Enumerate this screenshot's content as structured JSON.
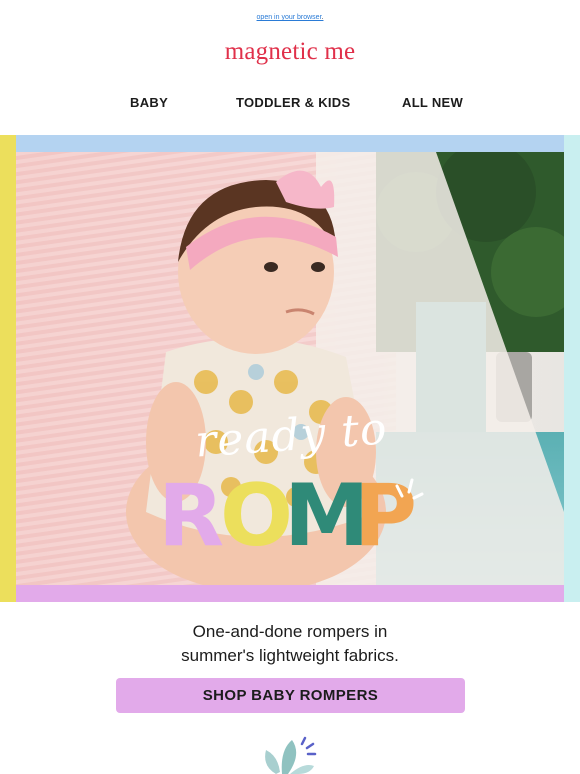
{
  "preheader": {
    "link_text": "open in your browser",
    "suffix": "."
  },
  "brand": {
    "logo_text": "magnetic me",
    "color": "#e0304a"
  },
  "nav": {
    "items": [
      {
        "label": "BABY"
      },
      {
        "label": "TODDLER & KIDS"
      },
      {
        "label": "ALL NEW"
      }
    ]
  },
  "hero": {
    "headline_script": "ready to",
    "headline_letters": [
      {
        "char": "R",
        "color": "#e2aaea"
      },
      {
        "char": "O",
        "color": "#ecdf5c"
      },
      {
        "char": "M",
        "color": "#2f8a78"
      },
      {
        "char": "P",
        "color": "#f2a552"
      }
    ],
    "frame_colors": {
      "top": "#b4d3f1",
      "left": "#ecdf5c",
      "right": "#c9eff0",
      "bottom": "#e2aaea"
    }
  },
  "copy": {
    "line1": "One-and-done rompers in",
    "line2": "summer's lightweight fabrics."
  },
  "cta": {
    "label": "SHOP BABY ROMPERS",
    "color": "#e2aaea"
  },
  "icons": {
    "footer_icon": "leaf-sparkle-icon"
  }
}
